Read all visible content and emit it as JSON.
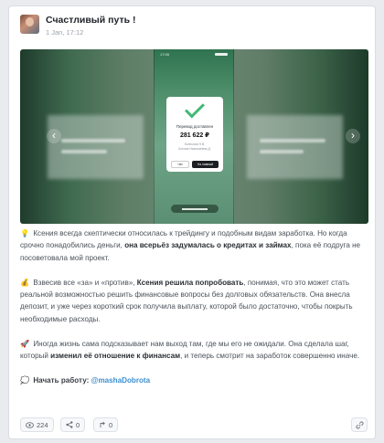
{
  "post": {
    "channel_name": "Счастливый путь !",
    "time": "1 Jan, 17:12"
  },
  "media": {
    "phone_status": "17:05",
    "receipt": {
      "title": "Перевод доставлен",
      "amount": "281 622 ₽",
      "line1": "Колесова Н.В.",
      "line2": "Ксения Николаевна Д.",
      "btn_check": "Чек",
      "btn_main": "На главный"
    },
    "prev_icon": "chevron-left-icon",
    "next_icon": "chevron-right-icon"
  },
  "content": {
    "p1": {
      "emoji": "💡",
      "t1": "Ксения всегда скептически относилась к трейдингу и подобным видам заработка. Но когда срочно понадобились деньги, ",
      "b1": "она всерьёз задумалась о кредитах и займах",
      "t2": ", пока её подруга не посоветовала мой проект."
    },
    "p2": {
      "emoji": "💰",
      "t1": "Взвесив все «за» и «против», ",
      "b1": "Ксения решила попробовать",
      "t2": ", понимая, что это может стать реальной возможностью решить финансовые вопросы без долговых обязательств. Она внесла депозит, и уже через короткий срок получила выплату, которой было достаточно, чтобы покрыть необходимые расходы."
    },
    "p3": {
      "emoji": "🚀",
      "t1": "Иногда жизнь сама подсказывает нам выход там, где мы его не ожидали. Она сделала шаг, который ",
      "b1": "изменил её отношение к финансам",
      "t2": ", и теперь смотрит на заработок совершенно иначе."
    },
    "cta": {
      "emoji": "💭",
      "label": "Начать работу:",
      "mention": "@mashaDobrota"
    }
  },
  "footer": {
    "views": "224",
    "shares": "0",
    "reposts": "0",
    "views_icon": "eye-icon",
    "shares_icon": "share-nodes-icon",
    "reposts_icon": "repost-arrow-icon",
    "link_icon": "link-icon"
  },
  "colors": {
    "accent": "#3b8fd1",
    "success": "#44b875"
  }
}
